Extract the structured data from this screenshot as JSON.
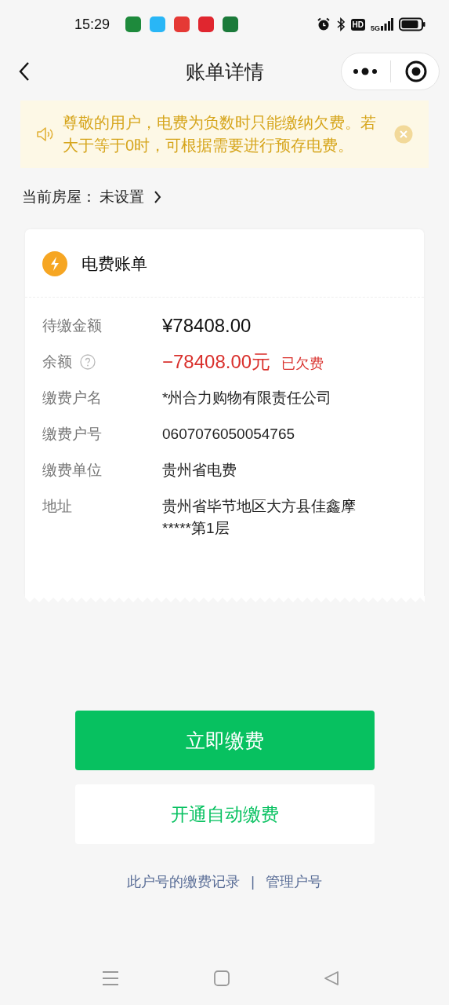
{
  "status_bar": {
    "time": "15:29",
    "app_icons": [
      {
        "color": "#1e8a3c"
      },
      {
        "color": "#29b6f6"
      },
      {
        "color": "#e53935"
      },
      {
        "color": "#e0262f"
      },
      {
        "color": "#1b7a3a"
      }
    ],
    "hd": "HD",
    "network": "5G"
  },
  "nav": {
    "title": "账单详情"
  },
  "notice": {
    "text": "尊敬的用户，电费为负数时只能缴纳欠费。若大于等于0时，可根据需要进行预存电费。"
  },
  "house": {
    "label": "当前房屋：",
    "value": "未设置"
  },
  "bill": {
    "title": "电费账单",
    "rows": [
      {
        "kind": "amount",
        "label": "待缴金额",
        "value": "¥78408.00"
      },
      {
        "kind": "balance",
        "label": "余额",
        "value": "−78408.00元",
        "tag": "已欠费"
      },
      {
        "kind": "plain",
        "label": "缴费户名",
        "value": "*州合力购物有限责任公司"
      },
      {
        "kind": "plain",
        "label": "缴费户号",
        "value": "0607076050054765"
      },
      {
        "kind": "plain",
        "label": "缴费单位",
        "value": "贵州省电费"
      },
      {
        "kind": "plain",
        "label": "地址",
        "value": "贵州省毕节地区大方县佳鑫摩*****第1层"
      }
    ]
  },
  "buttons": [
    {
      "kind": "primary",
      "label": "立即缴费"
    },
    {
      "kind": "secondary",
      "label": "开通自动缴费"
    }
  ],
  "links": [
    {
      "label": "此户号的缴费记录"
    },
    {
      "label": "管理户号"
    }
  ],
  "link_separator": "|"
}
